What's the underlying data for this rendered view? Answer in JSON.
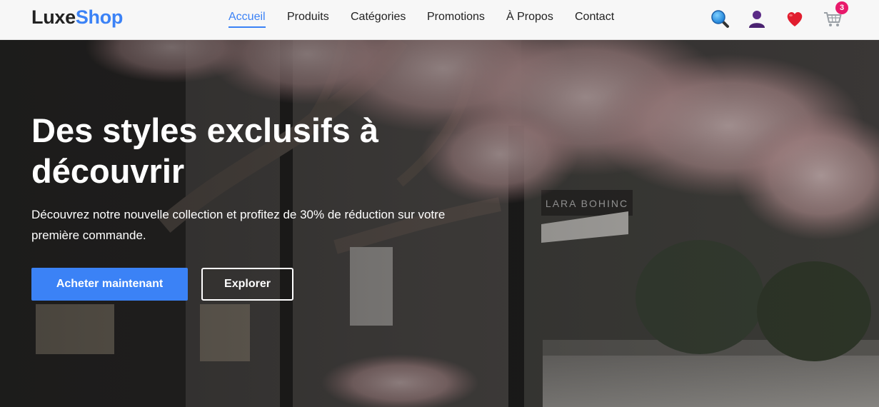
{
  "header": {
    "logo": {
      "part1": "Luxe",
      "part2": "Shop"
    },
    "nav": [
      {
        "label": "Accueil",
        "active": true
      },
      {
        "label": "Produits",
        "active": false
      },
      {
        "label": "Catégories",
        "active": false
      },
      {
        "label": "Promotions",
        "active": false
      },
      {
        "label": "À Propos",
        "active": false
      },
      {
        "label": "Contact",
        "active": false
      }
    ],
    "icons": [
      "search-icon",
      "user-icon",
      "heart-icon",
      "cart-icon"
    ],
    "cart_count": "3"
  },
  "hero": {
    "title": "Des styles exclusifs à découvrir",
    "subtitle": "Découvrez notre nouvelle collection et profitez de 30% de réduction sur votre première commande.",
    "primary_cta": "Acheter maintenant",
    "secondary_cta": "Explorer"
  },
  "colors": {
    "accent": "#3b82f6",
    "badge": "#e8196b",
    "heart": "#e11d2e",
    "user": "#5b2a86"
  }
}
